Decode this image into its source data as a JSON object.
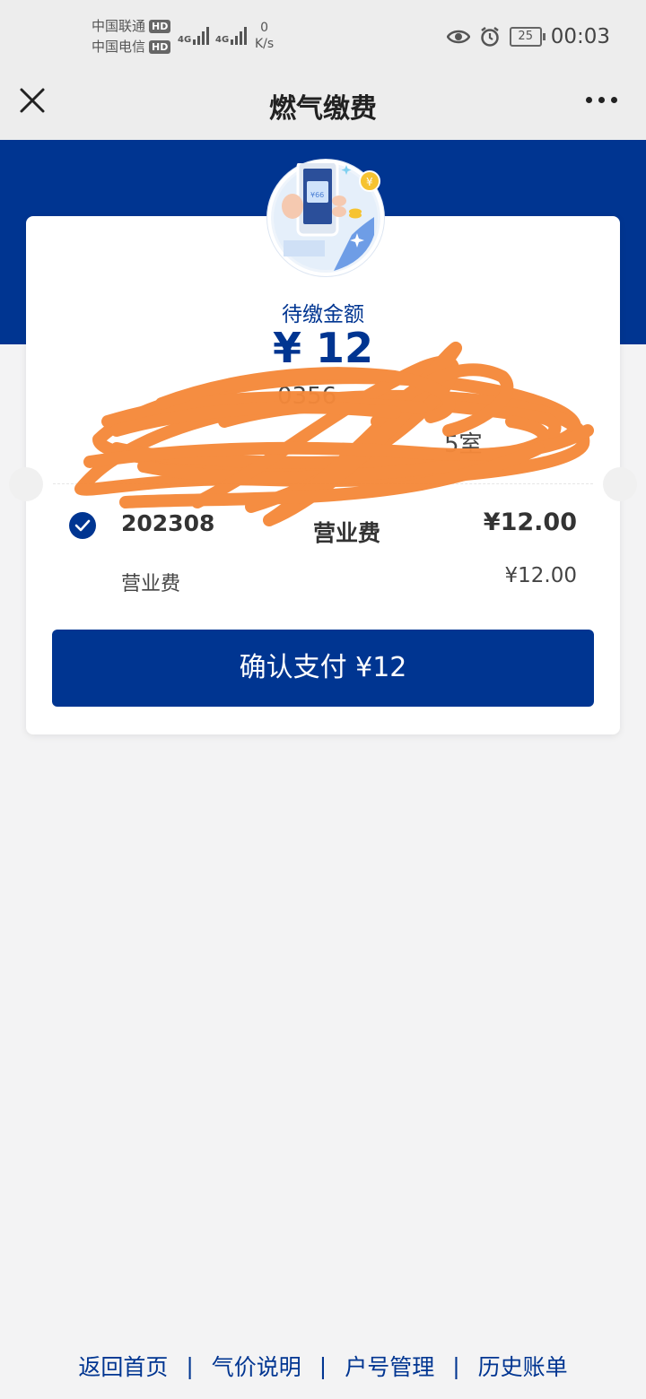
{
  "status_bar": {
    "carrier1": "中国联通",
    "carrier2": "中国电信",
    "hd": "HD",
    "net_type": "4G",
    "speed_value": "0",
    "speed_unit": "K/s",
    "battery": "25",
    "time": "00:03"
  },
  "nav": {
    "title": "燃气缴费"
  },
  "bill": {
    "amount_label": "待缴金额",
    "amount": "¥ 12",
    "account_fragment": "0356",
    "address_fragment": "5室",
    "period": "202308",
    "fee_type": "营业费",
    "fee_amount": "¥12.00",
    "item_name": "营业费",
    "item_amount": "¥12.00"
  },
  "pay_button": "确认支付 ¥12",
  "footer": {
    "links": [
      "返回首页",
      "气价说明",
      "户号管理",
      "历史账单"
    ],
    "separator": "|"
  },
  "colors": {
    "primary": "#003591",
    "scribble": "#f5893a"
  }
}
